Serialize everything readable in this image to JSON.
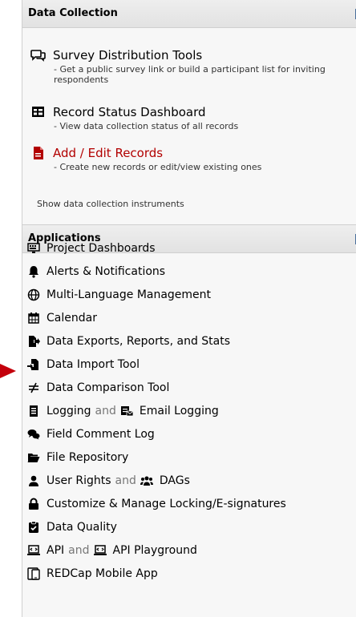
{
  "data_collection": {
    "title": "Data Collection",
    "items": [
      {
        "label": "Survey Distribution Tools",
        "desc": "- Get a public survey link or build a participant list for inviting respondents",
        "icon": "chat-bubbles-icon"
      },
      {
        "label": "Record Status Dashboard",
        "desc": "- View data collection status of all records",
        "icon": "table-grid-icon"
      },
      {
        "label": "Add / Edit Records",
        "desc": "- Create new records or edit/view existing ones",
        "icon": "document-edit-icon"
      }
    ],
    "show_instruments": "Show data collection instruments"
  },
  "applications": {
    "title": "Applications",
    "items": [
      {
        "label": "Project Dashboards",
        "icon": "dashboard-icon"
      },
      {
        "label": "Alerts & Notifications",
        "icon": "bell-icon"
      },
      {
        "label": "Multi-Language Management",
        "icon": "globe-icon"
      },
      {
        "label": "Calendar",
        "icon": "calendar-icon"
      },
      {
        "label": "Data Exports, Reports, and Stats",
        "icon": "file-export-icon"
      },
      {
        "label": "Data Import Tool",
        "icon": "file-import-icon"
      },
      {
        "label": "Data Comparison Tool",
        "icon": "not-equal-icon"
      },
      {
        "label": "Logging",
        "and": "and",
        "label2": "Email Logging",
        "icon": "list-icon",
        "icon2": "email-logging-icon"
      },
      {
        "label": "Field Comment Log",
        "icon": "comments-icon"
      },
      {
        "label": "File Repository",
        "icon": "folder-open-icon"
      },
      {
        "label": "User Rights",
        "and": "and",
        "label2": "DAGs",
        "icon": "user-icon",
        "icon2": "users-icon"
      },
      {
        "label": "Customize & Manage Locking/E-signatures",
        "icon": "lock-icon"
      },
      {
        "label": "Data Quality",
        "icon": "clipboard-check-icon"
      },
      {
        "label": "API",
        "and": "and",
        "label2": "API Playground",
        "icon": "laptop-code-icon",
        "icon2": "laptop-code-icon"
      },
      {
        "label": "REDCap Mobile App",
        "icon": "tablet-icon"
      }
    ]
  },
  "colors": {
    "accent_red": "#b20000",
    "arrow": "#c4000c"
  }
}
